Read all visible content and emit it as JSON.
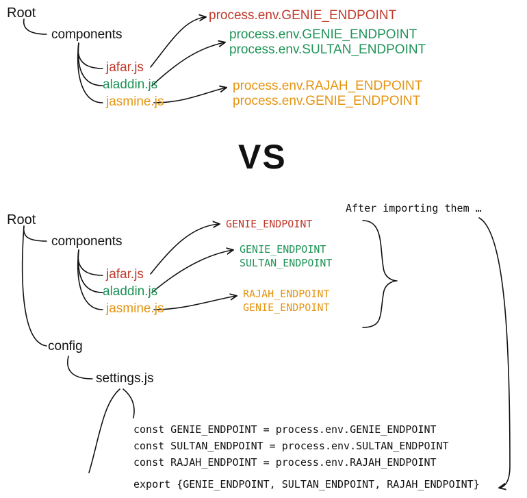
{
  "vs_label": "VS",
  "top": {
    "root_label": "Root",
    "components_label": "components",
    "files": {
      "jafar": {
        "name": "jafar.js",
        "color": "c-red"
      },
      "aladdin": {
        "name": "aladdin.js",
        "color": "c-green"
      },
      "jasmine": {
        "name": "jasmine.js",
        "color": "c-orange"
      }
    },
    "envs": {
      "jafar": {
        "line1": "process.env.GENIE_ENDPOINT"
      },
      "aladdin": {
        "line1": "process.env.GENIE_ENDPOINT",
        "line2": "process.env.SULTAN_ENDPOINT"
      },
      "jasmine": {
        "line1": "process.env.RAJAH_ENDPOINT",
        "line2": "process.env.GENIE_ENDPOINT"
      }
    }
  },
  "bottom": {
    "root_label": "Root",
    "components_label": "components",
    "config_label": "config",
    "settings_label": "settings.js",
    "after_import_label": "After importing them …",
    "files": {
      "jafar": {
        "name": "jafar.js",
        "color": "c-red"
      },
      "aladdin": {
        "name": "aladdin.js",
        "color": "c-green"
      },
      "jasmine": {
        "name": "jasmine.js",
        "color": "c-orange"
      }
    },
    "envs": {
      "jafar": {
        "line1": "GENIE_ENDPOINT"
      },
      "aladdin": {
        "line1": "GENIE_ENDPOINT",
        "line2": "SULTAN_ENDPOINT"
      },
      "jasmine": {
        "line1": "RAJAH_ENDPOINT",
        "line2": "GENIE_ENDPOINT"
      }
    },
    "code": {
      "l1": "const GENIE_ENDPOINT = process.env.GENIE_ENDPOINT",
      "l2": "const SULTAN_ENDPOINT = process.env.SULTAN_ENDPOINT",
      "l3": "const RAJAH_ENDPOINT = process.env.RAJAH_ENDPOINT",
      "l4": "export {GENIE_ENDPOINT, SULTAN_ENDPOINT, RAJAH_ENDPOINT}"
    }
  }
}
